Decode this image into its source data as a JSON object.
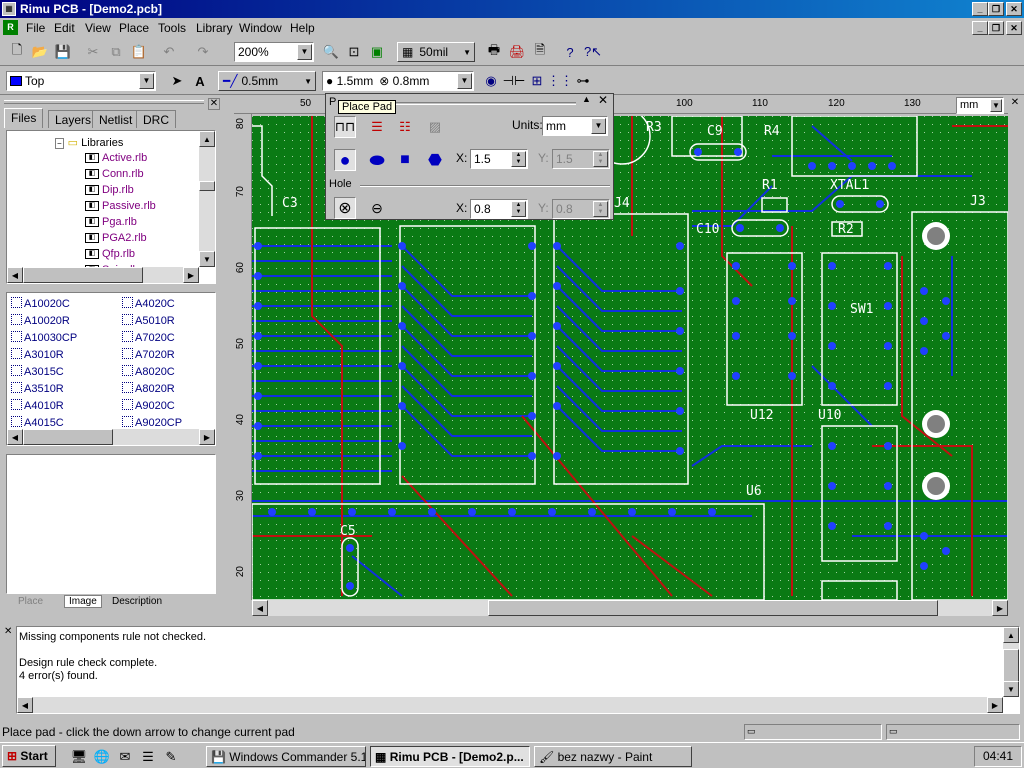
{
  "window": {
    "title": "Rimu PCB - [Demo2.pcb]"
  },
  "menu": [
    "File",
    "Edit",
    "View",
    "Place",
    "Tools",
    "Library",
    "Window",
    "Help"
  ],
  "toolbar": {
    "zoom": "200%",
    "grid": "50mil",
    "layer": "Top",
    "track_width": "0.5mm",
    "via_size": "1.5mm",
    "via_hole": "0.8mm"
  },
  "panel": {
    "tabs": [
      "Files",
      "Layers",
      "Netlist",
      "DRC"
    ],
    "tree_root": "Libraries",
    "libraries": [
      "Active.rlb",
      "Conn.rlb",
      "Dip.rlb",
      "Passive.rlb",
      "Pga.rlb",
      "PGA2.rlb",
      "Qfp.rlb",
      "Soic.rlb"
    ],
    "parts_left": [
      "A10020C",
      "A10020R",
      "A10030CP",
      "A3010R",
      "A3015C",
      "A3510R",
      "A4010R",
      "A4015C"
    ],
    "parts_right": [
      "A4020C",
      "A5010R",
      "A7020C",
      "A7020R",
      "A8020C",
      "A8020R",
      "A9020C",
      "A9020CP"
    ],
    "bottom_tabs": [
      "Place",
      "Image",
      "Description"
    ]
  },
  "rulers": {
    "top": [
      "50",
      "100",
      "110",
      "120",
      "130"
    ],
    "left": [
      "80",
      "70",
      "60",
      "50",
      "40",
      "30",
      "20"
    ],
    "units": "mm"
  },
  "pad_popup": {
    "title": "P",
    "tooltip": "Place Pad",
    "units_label": "Units:",
    "units_value": "mm",
    "x_label": "X:",
    "y_label": "Y:",
    "pad_x": "1.5",
    "pad_y": "1.5",
    "hole_label": "Hole",
    "hole_x": "0.8",
    "hole_y": "0.8"
  },
  "board_labels": [
    "R3",
    "C9",
    "R4",
    "R1",
    "XTAL1",
    "C3",
    "J4",
    "C10",
    "R2",
    "J3",
    "SW1",
    "U12",
    "U10",
    "U6",
    "C5"
  ],
  "messages": [
    "Missing components rule not checked.",
    "",
    "Design rule check complete.",
    "4 error(s) found."
  ],
  "statusbar": {
    "text": "Place pad - click the down arrow to change current pad"
  },
  "taskbar": {
    "start": "Start",
    "tasks": [
      "Windows Commander 5.11...",
      "Rimu PCB - [Demo2.p...",
      "bez nazwy - Paint"
    ],
    "clock": "04:41"
  },
  "colors": {
    "board": "#0a7a14",
    "track_blue": "#1030e0",
    "track_red": "#c01010",
    "silk": "#ffffff"
  }
}
